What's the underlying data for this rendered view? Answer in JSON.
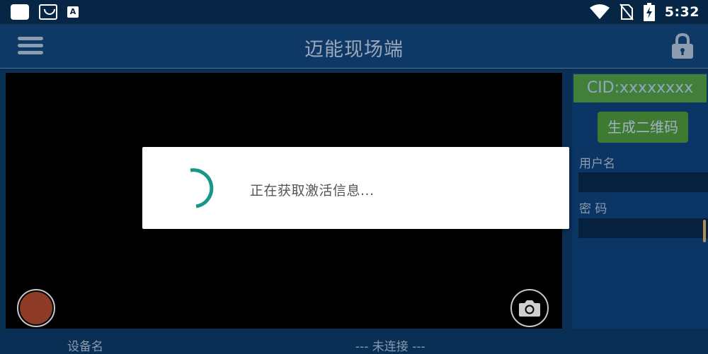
{
  "status_bar": {
    "time": "5:32",
    "icons": [
      "app-square-icon",
      "inbox-icon",
      "font-a-icon",
      "wifi-icon",
      "no-sim-icon",
      "battery-charging-icon"
    ],
    "font_badge": "A"
  },
  "app_bar": {
    "title": "迈能现场端",
    "menu_icon": "hamburger-menu-icon",
    "lock_icon": "lock-icon"
  },
  "video": {
    "record_icon": "record-icon",
    "camera_icon": "camera-icon"
  },
  "panel": {
    "cid": "CID:xxxxxxxx",
    "qr_button": "生成二维码",
    "username_label": "用户名",
    "username_value": "",
    "password_label": "密 码",
    "password_value": ""
  },
  "bottom_bar": {
    "device_name": "设备名",
    "connection_status": "--- 未连接 ---"
  },
  "dialog": {
    "message": "正在获取激活信息...",
    "spinner_icon": "loading-spinner-icon"
  },
  "colors": {
    "background": "#0a2f55",
    "app_bar": "#0e3865",
    "accent_green": "#42803a",
    "spinner_teal": "#16978a"
  }
}
